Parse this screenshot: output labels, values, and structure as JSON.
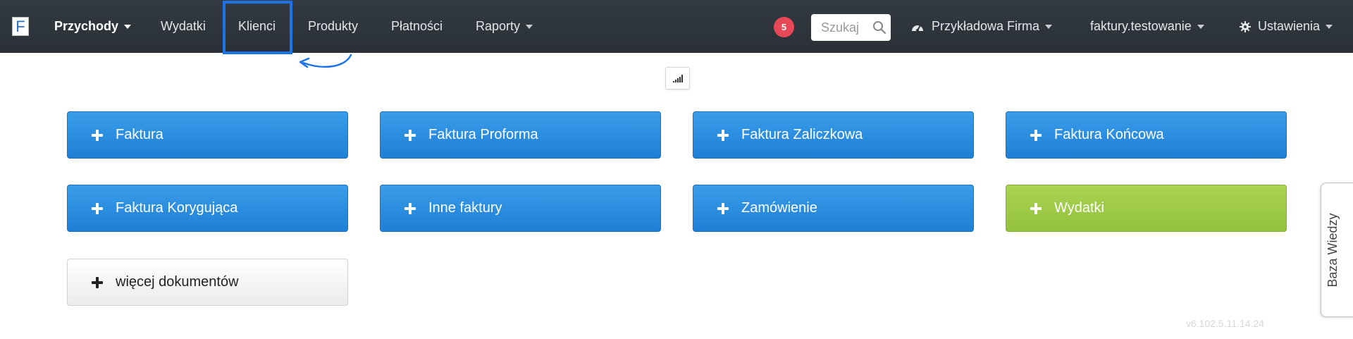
{
  "nav": {
    "logo": "F",
    "items": [
      {
        "label": "Przychody",
        "dropdown": true,
        "bold": true
      },
      {
        "label": "Wydatki"
      },
      {
        "label": "Klienci",
        "highlighted": true
      },
      {
        "label": "Produkty"
      },
      {
        "label": "Płatności"
      },
      {
        "label": "Raporty",
        "dropdown": true
      }
    ],
    "notification_count": "5",
    "search_placeholder": "Szukaj",
    "company": "Przykładowa Firma",
    "account": "faktury.testowanie",
    "settings": "Ustawienia"
  },
  "buttons": {
    "row1": [
      "Faktura",
      "Faktura Proforma",
      "Faktura Zaliczkowa",
      "Faktura Końcowa"
    ],
    "row2": [
      "Faktura Korygująca",
      "Inne faktury",
      "Zamówienie",
      "Wydatki"
    ],
    "more": "więcej dokumentów"
  },
  "side_tab": "Baza Wiedzy",
  "version": "v6.102.5.11.14.24",
  "colors": {
    "navbar": "#2f353b",
    "primary_button": "#2b8ae0",
    "expense_button": "#9dca47",
    "badge": "#e74856",
    "highlight": "#1e73e6"
  }
}
